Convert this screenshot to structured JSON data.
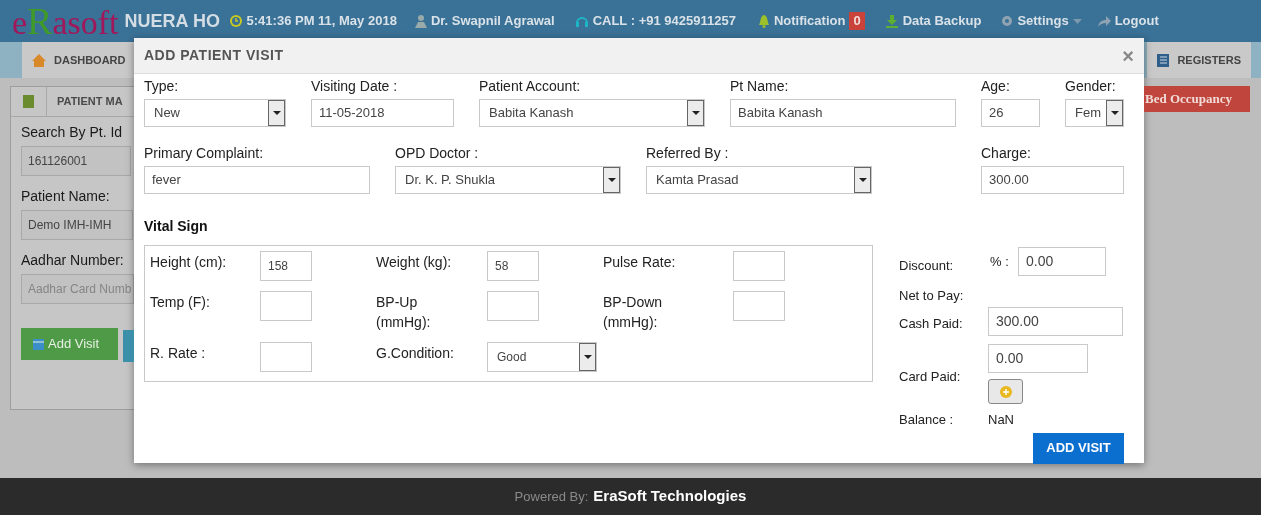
{
  "header": {
    "logo": [
      {
        "text": "e",
        "color": "#a0185a"
      },
      {
        "text": "R",
        "color": "#3f9a2a"
      },
      {
        "text": "asoft",
        "color": "#a0185a"
      }
    ],
    "hospital": "NUERA HO",
    "clock": "5:41:36 PM 11, May 2018",
    "user": "Dr. Swapnil Agrawal",
    "call": "CALL : +91 9425911257",
    "notification": {
      "label": "Notification",
      "count": "0"
    },
    "backup": "Data Backup",
    "settings": "Settings",
    "logout": "Logout"
  },
  "nav": [
    {
      "label": "DASHBOARD"
    },
    {
      "label": "REGISTERS"
    }
  ],
  "panel": {
    "title": "PATIENT MA",
    "search_label": "Search By Pt. Id",
    "search_value": "161126001",
    "name_label": "Patient Name:",
    "name_value": "Demo IMH-IMH",
    "aadhar_label": "Aadhar Number:",
    "aadhar_placeholder": "Aadhar Card Numb",
    "add_visit": "Add Visit"
  },
  "bed_occupancy": "Bed Occupancy",
  "modal": {
    "title": "ADD PATIENT VISIT",
    "close": "×",
    "row1": [
      {
        "kind": "select",
        "label": "Type:",
        "value": "New"
      },
      {
        "kind": "input",
        "label": "Visiting Date :",
        "value": "11-05-2018"
      },
      {
        "kind": "select",
        "label": "Patient Account:",
        "value": "Babita Kanash"
      },
      {
        "kind": "input",
        "label": "Pt Name:",
        "value": "Babita Kanash"
      },
      {
        "kind": "input",
        "label": "Age:",
        "value": "26"
      },
      {
        "kind": "select",
        "label": "Gender:",
        "value": "Fem"
      }
    ],
    "row2": [
      {
        "kind": "input",
        "label": "Primary Complaint:",
        "value": "fever"
      },
      {
        "kind": "select",
        "label": "OPD Doctor :",
        "value": "Dr. K. P. Shukla"
      },
      {
        "kind": "select",
        "label": "Referred By :",
        "value": "Kamta Prasad"
      },
      {
        "kind": "input",
        "label": "Charge:",
        "value": "300.00"
      }
    ],
    "vital_title": "Vital Sign",
    "vitals": [
      {
        "kind": "input",
        "label": "Height (cm):",
        "value": "158"
      },
      {
        "kind": "input",
        "label": "Weight (kg):",
        "value": "58"
      },
      {
        "kind": "input",
        "label": "Pulse Rate:"
      },
      {
        "kind": "input",
        "label": "Temp (F):"
      },
      {
        "kind": "input",
        "label": "BP-Up (mmHg):"
      },
      {
        "kind": "input",
        "label": "BP-Down (mmHg):"
      },
      {
        "kind": "input",
        "label": "R. Rate :"
      },
      {
        "kind": "select",
        "label": "G.Condition:",
        "value": "Good"
      }
    ],
    "billing": {
      "discount_label": "Discount:",
      "percent_label": "% :",
      "discount_value": "0.00",
      "net_label": "Net to Pay:",
      "cash_label": "Cash Paid:",
      "cash_value": "300.00",
      "card_label": "Card Paid:",
      "card_value": "0.00",
      "balance_label": "Balance :",
      "balance_value": "NaN"
    },
    "submit": "ADD VISIT"
  },
  "footer": {
    "prefix": "Powered By:",
    "company": "EraSoft Technologies"
  }
}
